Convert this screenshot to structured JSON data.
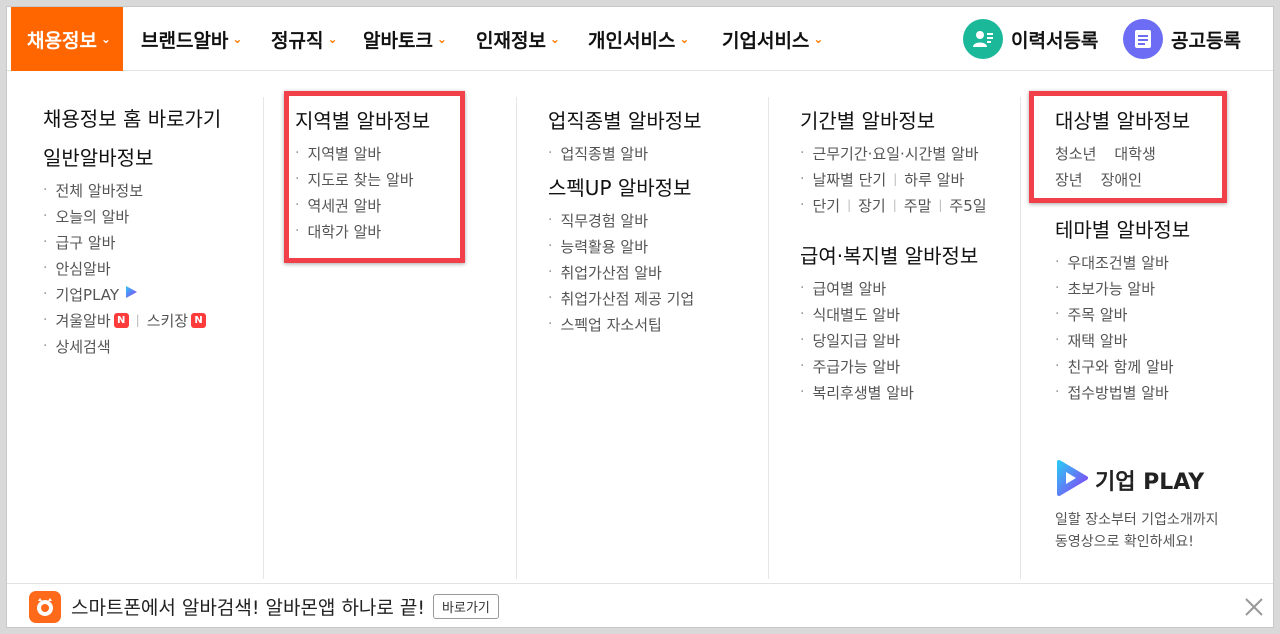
{
  "nav": {
    "items": [
      {
        "label": "채용정보",
        "active": true
      },
      {
        "label": "브랜드알바"
      },
      {
        "label": "정규직"
      },
      {
        "label": "알바토크"
      },
      {
        "label": "인재정보"
      },
      {
        "label": "개인서비스"
      },
      {
        "label": "기업서비스"
      }
    ],
    "resume_label": "이력서등록",
    "post_label": "공고등록"
  },
  "col1": {
    "home_link": "채용정보 홈 바로가기",
    "title": "일반알바정보",
    "items": [
      "전체 알바정보",
      "오늘의 알바",
      "급구 알바",
      "안심알바",
      "기업PLAY"
    ],
    "winter": "겨울알바",
    "ski": "스키장",
    "new_badge": "N",
    "detail": "상세검색"
  },
  "col2": {
    "title": "지역별 알바정보",
    "items": [
      "지역별 알바",
      "지도로 찾는 알바",
      "역세권 알바",
      "대학가 알바"
    ]
  },
  "col3": {
    "title": "업직종별 알바정보",
    "items": [
      "업직종별 알바"
    ],
    "title2": "스펙UP 알바정보",
    "items2": [
      "직무경험 알바",
      "능력활용 알바",
      "취업가산점 알바",
      "취업가산점 제공 기업",
      "스펙업 자소서팁"
    ]
  },
  "col4": {
    "title": "기간별 알바정보",
    "line1": "근무기간·요일·시간별 알바",
    "line2a": "날짜별 단기",
    "line2b": "하루 알바",
    "line3": [
      "단기",
      "장기",
      "주말",
      "주5일"
    ],
    "title2": "급여·복지별 알바정보",
    "items2": [
      "급여별 알바",
      "식대별도 알바",
      "당일지급 알바",
      "주급가능 알바",
      "복리후생별 알바"
    ]
  },
  "col5": {
    "title": "대상별 알바정보",
    "row1": [
      "청소년",
      "대학생"
    ],
    "row2": [
      "장년",
      "장애인"
    ],
    "title2": "테마별 알바정보",
    "items2": [
      "우대조건별 알바",
      "초보가능 알바",
      "주목 알바",
      "재택 알바",
      "친구와 함께 알바",
      "접수방법별 알바"
    ]
  },
  "kplay": {
    "title": "기업 PLAY",
    "desc1": "일할 장소부터 기업소개까지",
    "desc2": "동영상으로 확인하세요!"
  },
  "bottom": {
    "text": "스마트폰에서 알바검색! 알바몬앱 하나로 끝!",
    "button": "바로가기"
  },
  "colors": {
    "accent": "#ff6600",
    "highlight": "#f2404a"
  }
}
